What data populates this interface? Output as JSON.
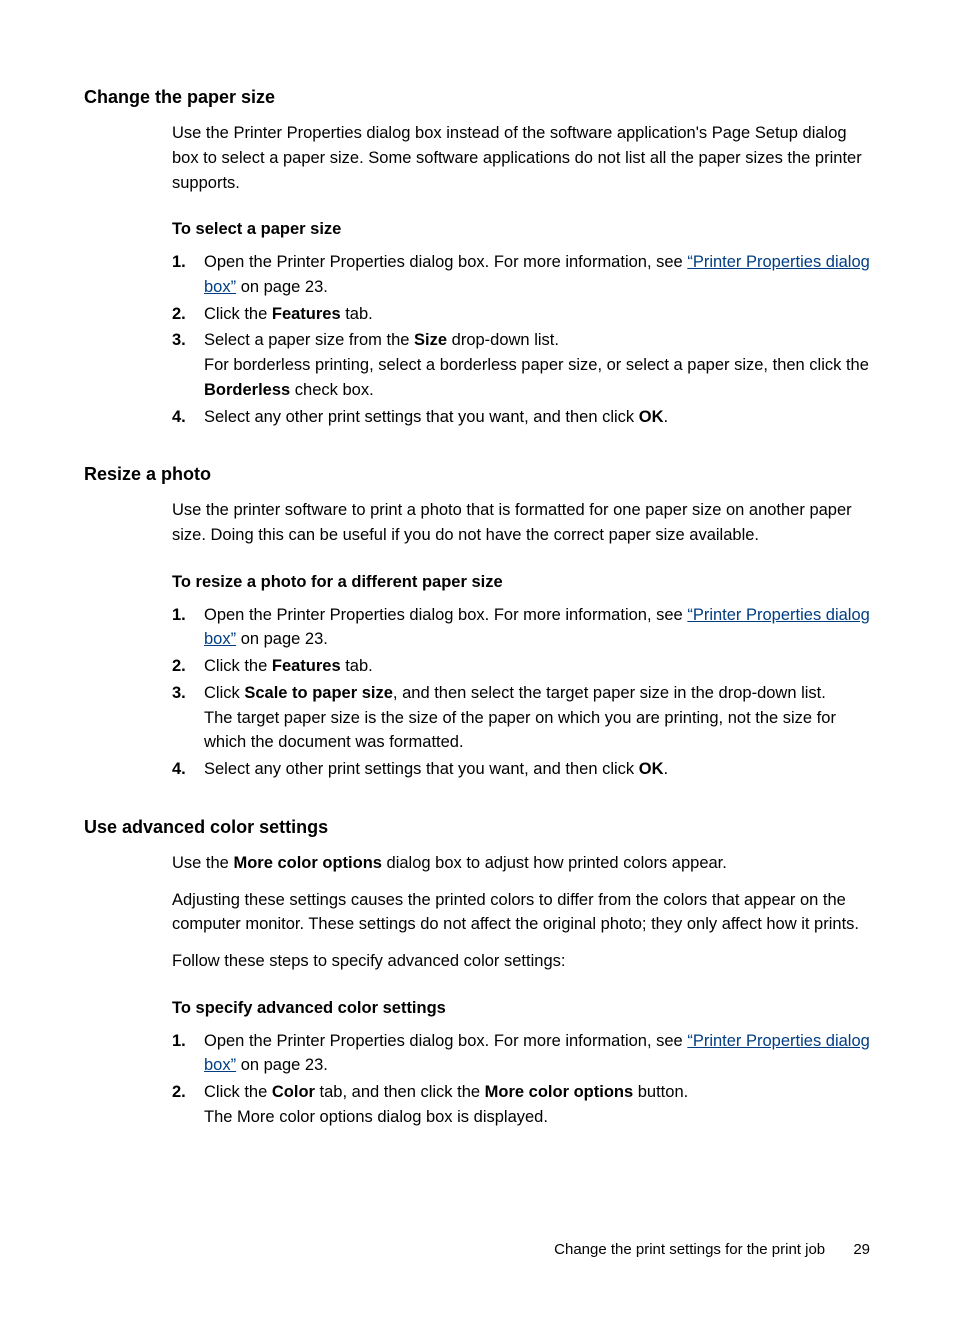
{
  "sections": [
    {
      "heading": "Change the paper size",
      "intro_parts": [
        "Use the Printer Properties dialog box instead of the software application's Page Setup dialog box to select a paper size. Some software applications do not list all the paper sizes the printer supports."
      ],
      "subheading": "To select a paper size",
      "steps": [
        {
          "num": "1.",
          "parts": [
            {
              "t": "text",
              "v": "Open the Printer Properties dialog box. For more information, see "
            },
            {
              "t": "link",
              "v": "“Printer Properties dialog box”"
            },
            {
              "t": "text",
              "v": " on page 23."
            }
          ]
        },
        {
          "num": "2.",
          "parts": [
            {
              "t": "text",
              "v": "Click the "
            },
            {
              "t": "bold",
              "v": "Features"
            },
            {
              "t": "text",
              "v": " tab."
            }
          ]
        },
        {
          "num": "3.",
          "lines": [
            [
              {
                "t": "text",
                "v": "Select a paper size from the "
              },
              {
                "t": "bold",
                "v": "Size"
              },
              {
                "t": "text",
                "v": " drop-down list."
              }
            ],
            [
              {
                "t": "text",
                "v": "For borderless printing, select a borderless paper size, or select a paper size, then click the "
              },
              {
                "t": "bold",
                "v": "Borderless"
              },
              {
                "t": "text",
                "v": " check box."
              }
            ]
          ]
        },
        {
          "num": "4.",
          "parts": [
            {
              "t": "text",
              "v": "Select any other print settings that you want, and then click "
            },
            {
              "t": "bold",
              "v": "OK"
            },
            {
              "t": "text",
              "v": "."
            }
          ]
        }
      ]
    },
    {
      "heading": "Resize a photo",
      "intro_parts": [
        "Use the printer software to print a photo that is formatted for one paper size on another paper size. Doing this can be useful if you do not have the correct paper size available."
      ],
      "subheading": "To resize a photo for a different paper size",
      "steps": [
        {
          "num": "1.",
          "parts": [
            {
              "t": "text",
              "v": "Open the Printer Properties dialog box. For more information, see "
            },
            {
              "t": "link",
              "v": "“Printer Properties dialog box”"
            },
            {
              "t": "text",
              "v": " on page 23."
            }
          ]
        },
        {
          "num": "2.",
          "parts": [
            {
              "t": "text",
              "v": "Click the "
            },
            {
              "t": "bold",
              "v": "Features"
            },
            {
              "t": "text",
              "v": " tab."
            }
          ]
        },
        {
          "num": "3.",
          "lines": [
            [
              {
                "t": "text",
                "v": "Click "
              },
              {
                "t": "bold",
                "v": "Scale to paper size"
              },
              {
                "t": "text",
                "v": ", and then select the target paper size in the drop-down list."
              }
            ],
            [
              {
                "t": "text",
                "v": "The target paper size is the size of the paper on which you are printing, not the size for which the document was formatted."
              }
            ]
          ]
        },
        {
          "num": "4.",
          "parts": [
            {
              "t": "text",
              "v": "Select any other print settings that you want, and then click "
            },
            {
              "t": "bold",
              "v": "OK"
            },
            {
              "t": "text",
              "v": "."
            }
          ]
        }
      ]
    },
    {
      "heading": "Use advanced color settings",
      "intro_multi": [
        [
          {
            "t": "text",
            "v": "Use the "
          },
          {
            "t": "bold",
            "v": "More color options"
          },
          {
            "t": "text",
            "v": " dialog box to adjust how printed colors appear."
          }
        ],
        [
          {
            "t": "text",
            "v": "Adjusting these settings causes the printed colors to differ from the colors that appear on the computer monitor. These settings do not affect the original photo; they only affect how it prints."
          }
        ],
        [
          {
            "t": "text",
            "v": "Follow these steps to specify advanced color settings:"
          }
        ]
      ],
      "subheading": "To specify advanced color settings",
      "steps": [
        {
          "num": "1.",
          "parts": [
            {
              "t": "text",
              "v": "Open the Printer Properties dialog box. For more information, see "
            },
            {
              "t": "link",
              "v": "“Printer Properties dialog box”"
            },
            {
              "t": "text",
              "v": " on page 23."
            }
          ]
        },
        {
          "num": "2.",
          "lines": [
            [
              {
                "t": "text",
                "v": "Click the "
              },
              {
                "t": "bold",
                "v": "Color"
              },
              {
                "t": "text",
                "v": " tab, and then click the "
              },
              {
                "t": "bold",
                "v": "More color options"
              },
              {
                "t": "text",
                "v": " button."
              }
            ],
            [
              {
                "t": "text",
                "v": "The More color options dialog box is displayed."
              }
            ]
          ]
        }
      ]
    }
  ],
  "footer": {
    "text": "Change the print settings for the print job",
    "page": "29"
  }
}
